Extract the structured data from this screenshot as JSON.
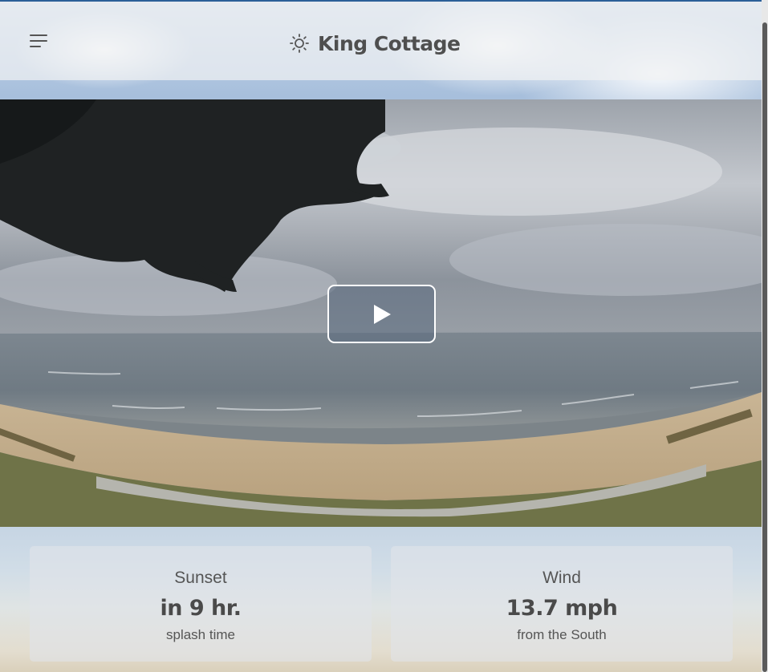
{
  "header": {
    "title": "King Cottage",
    "menu_icon": "menu-icon",
    "logo_icon": "sun-icon"
  },
  "webcam": {
    "play_icon": "play-icon"
  },
  "cards": [
    {
      "label": "Sunset",
      "value": "in 9 hr.",
      "note": "splash time"
    },
    {
      "label": "Wind",
      "value": "13.7 mph",
      "note": "from the South"
    }
  ],
  "colors": {
    "title_text": "#4f4f4f",
    "accent_border": "#2b5f98"
  }
}
